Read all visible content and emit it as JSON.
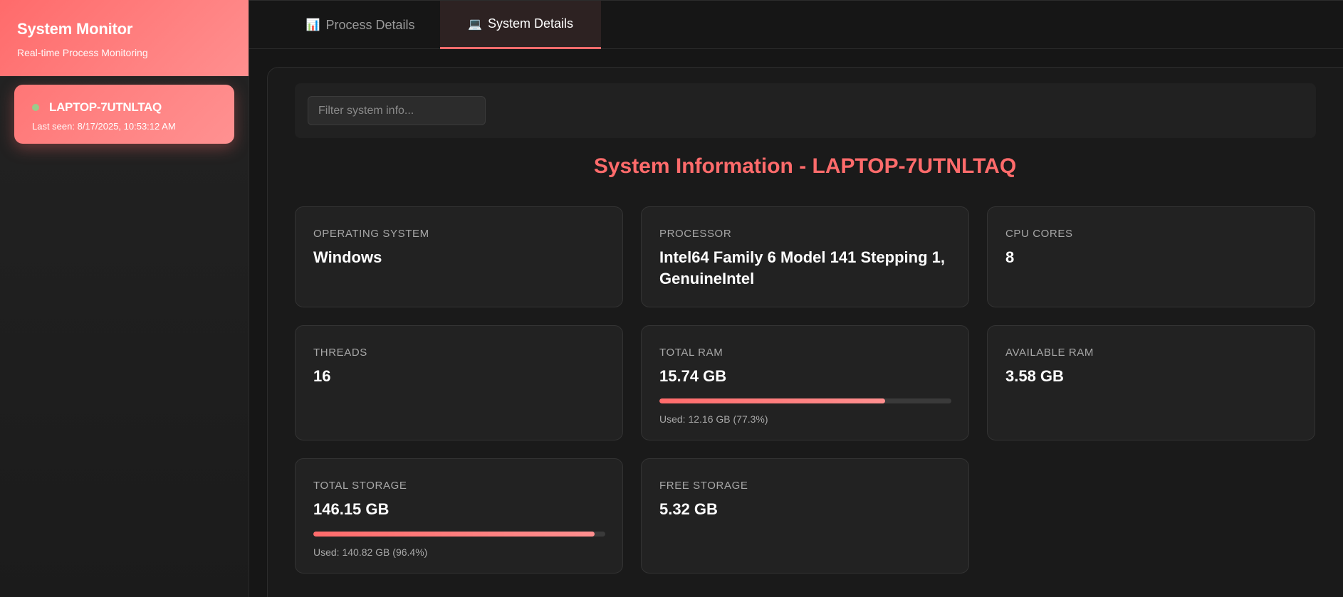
{
  "sidebar": {
    "title": "System Monitor",
    "subtitle": "Real-time Process Monitoring",
    "devices": [
      {
        "name": "LAPTOP-7UTNLTAQ",
        "last_seen": "Last seen: 8/17/2025, 10:53:12 AM",
        "status": "online"
      }
    ]
  },
  "tabs": [
    {
      "icon": "📊",
      "label": "Process Details",
      "active": false
    },
    {
      "icon": "💻",
      "label": "System Details",
      "active": true
    }
  ],
  "filter": {
    "placeholder": "Filter system info..."
  },
  "panel_title": "System Information - LAPTOP-7UTNLTAQ",
  "cards": {
    "os": {
      "label": "Operating System",
      "value": "Windows"
    },
    "processor": {
      "label": "Processor",
      "value": "Intel64 Family 6 Model 141 Stepping 1, GenuineIntel"
    },
    "cpu_cores": {
      "label": "CPU Cores",
      "value": "8"
    },
    "threads": {
      "label": "Threads",
      "value": "16"
    },
    "total_ram": {
      "label": "Total RAM",
      "value": "15.74 GB",
      "usage_percent": 77.3,
      "note": "Used: 12.16 GB (77.3%)"
    },
    "available_ram": {
      "label": "Available RAM",
      "value": "3.58 GB"
    },
    "total_storage": {
      "label": "Total Storage",
      "value": "146.15 GB",
      "usage_percent": 96.4,
      "note": "Used: 140.82 GB (96.4%)"
    },
    "free_storage": {
      "label": "Free Storage",
      "value": "5.32 GB"
    }
  },
  "colors": {
    "accent": "#ff6b6b",
    "status_online": "#9acb8b",
    "background": "#161616",
    "card_background": "#222222"
  }
}
